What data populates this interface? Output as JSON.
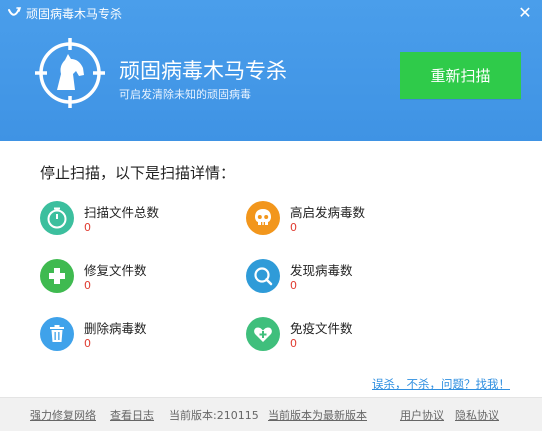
{
  "window": {
    "title": "顽固病毒木马专杀",
    "close_icon": "close-icon"
  },
  "hero": {
    "title": "顽固病毒木马专杀",
    "subtitle": "可启发清除未知的顽固病毒",
    "rescan_label": "重新扫描"
  },
  "status": {
    "heading": "停止扫描，以下是扫描详情："
  },
  "stats": [
    {
      "label": "扫描文件总数",
      "value": "0",
      "icon": "timer-icon",
      "color": "#3cbf9e"
    },
    {
      "label": "高启发病毒数",
      "value": "0",
      "icon": "skull-icon",
      "color": "#f2961c"
    },
    {
      "label": "修复文件数",
      "value": "0",
      "icon": "plus-icon",
      "color": "#3fba50"
    },
    {
      "label": "发现病毒数",
      "value": "0",
      "icon": "search-icon",
      "color": "#2f9bd8"
    },
    {
      "label": "删除病毒数",
      "value": "0",
      "icon": "trash-icon",
      "color": "#3fa2ea"
    },
    {
      "label": "免疫文件数",
      "value": "0",
      "icon": "heart-icon",
      "color": "#3fbf7c"
    }
  ],
  "feedback_link": "误杀，不杀，问题？找我！",
  "footer": {
    "repair_network": "强力修复网络",
    "view_log": "查看日志",
    "version_label": "当前版本:210115",
    "latest_note": "当前版本为最新版本",
    "user_agreement": "用户协议",
    "privacy": "隐私协议"
  },
  "colors": {
    "header_bg": "#4a9eeb",
    "rescan_bg": "#2fcb4a",
    "value_red": "#e03c31",
    "link_blue": "#2f8fe0"
  }
}
